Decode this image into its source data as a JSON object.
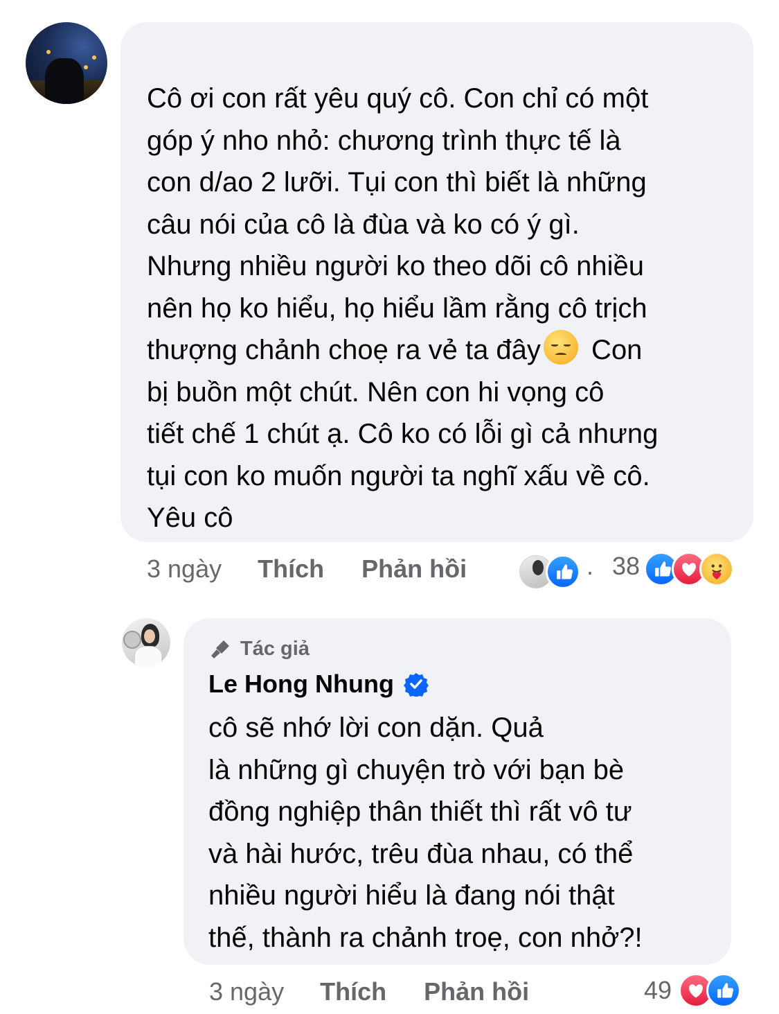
{
  "comment1": {
    "text": "Cô ơi con rất yêu quý cô. Con chỉ có một\ngóp ý nho nhỏ: chương trình thực tế là\ncon d/ao 2 lưỡi. Tụi con thì biết là những\ncâu nói của cô là đùa và ko có ý gì.\nNhưng nhiều người ko theo dõi cô nhiều\nnên họ ko hiểu, họ hiểu lầm rằng cô trịch\nthượng chảnh choẹ ra vẻ ta đây",
    "text_after_emoji": " Con\nbị buồn một chút. Nên con hi vọng cô\ntiết chế 1 chút ạ. Cô ko có lỗi gì cả nhưng\ntụi con ko muốn người ta nghĩ xấu về cô.\nYêu cô",
    "emoji": "disappointed-face",
    "time": "3 ngày",
    "like_label": "Thích",
    "reply_label": "Phản hồi",
    "reply_preview_reaction": "like",
    "reaction_count": "38",
    "reactions": [
      "like",
      "love",
      "care"
    ]
  },
  "reply1": {
    "badge": "Tác giả",
    "author": "Le Hong Nhung",
    "verified": true,
    "text": "             cô sẽ nhớ lời con dặn. Quả\nlà những gì chuyện trò với bạn bè\nđồng nghiệp thân thiết thì rất vô tư\nvà hài hước, trêu đùa nhau, có thể\nnhiều người hiểu là đang nói thật\nthế, thành ra chảnh troẹ, con nhở?!",
    "time": "3 ngày",
    "like_label": "Thích",
    "reply_label": "Phản hồi",
    "reaction_count": "49",
    "reactions": [
      "love",
      "like"
    ]
  },
  "colors": {
    "bubble": "#f0f2f5",
    "meta_text": "#65676b",
    "like_blue": "#0866ff",
    "love_red": "#e41e3f"
  }
}
